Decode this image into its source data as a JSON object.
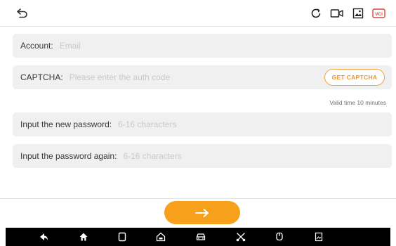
{
  "header": {
    "icons": [
      "back-arrow-icon",
      "refresh-icon",
      "video-record-icon",
      "gallery-icon",
      "vci-icon"
    ],
    "vci_label": "VCI"
  },
  "form": {
    "account": {
      "label": "Account:",
      "placeholder": "Email"
    },
    "captcha": {
      "label": "CAPTCHA:",
      "placeholder": "Please enter the auth code",
      "button_label": "GET CAPTCHA",
      "valid_note": "Valid time 10 minutes"
    },
    "new_password": {
      "label": "Input the new password:",
      "placeholder": "6-16 characters"
    },
    "confirm_password": {
      "label": "Input the password again:",
      "placeholder": "6-16 characters"
    }
  },
  "next_button": {
    "icon": "arrow-right-icon",
    "color": "#f7a01b"
  },
  "navbar": {
    "icons": [
      "back-icon",
      "home-icon",
      "recent-apps-icon",
      "garage-home-icon",
      "vehicle-icon",
      "tools-icon",
      "vci-connect-icon",
      "screenshot-icon"
    ]
  }
}
